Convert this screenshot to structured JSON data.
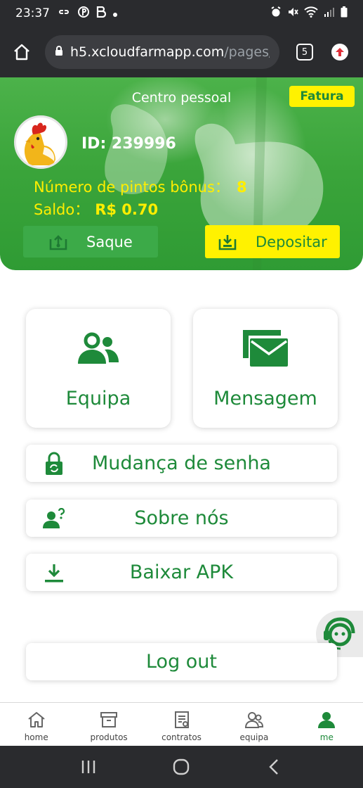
{
  "status_bar": {
    "time": "23:37",
    "left_icons": [
      "link-icon",
      "pinterest-icon",
      "b-icon",
      "dot-icon"
    ],
    "right_icons": [
      "alarm-icon",
      "mute-icon",
      "wifi-icon",
      "signal-icon",
      "battery-icon"
    ]
  },
  "browser": {
    "url_host": "h5.xcloudfarmapp.com",
    "url_path": "/pages/",
    "tab_count": "5"
  },
  "header": {
    "title": "Centro pessoal",
    "fatura_label": "Fatura",
    "user_id_label": "ID: 239996",
    "bonus_label": "Número de pintos bônus：",
    "bonus_value": "8",
    "saldo_label": "Saldo：",
    "saldo_value": "R$ 0.70",
    "saque_label": "Saque",
    "depositar_label": "Depositar"
  },
  "cards": {
    "equipa_label": "Equipa",
    "mensagem_label": "Mensagem"
  },
  "menu": {
    "senha_label": "Mudança de senha",
    "sobre_label": "Sobre nós",
    "apk_label": "Baixar APK",
    "logout_label": "Log out"
  },
  "bottom_nav": {
    "items": [
      {
        "label": "home",
        "icon": "home-icon"
      },
      {
        "label": "produtos",
        "icon": "box-icon"
      },
      {
        "label": "contratos",
        "icon": "contract-icon"
      },
      {
        "label": "equipa",
        "icon": "team-icon"
      },
      {
        "label": "me",
        "icon": "user-icon"
      }
    ],
    "active": "me"
  },
  "colors": {
    "primary_green": "#1e8a3a",
    "banner_green": "#3aa43a",
    "accent_yellow": "#fff200"
  }
}
